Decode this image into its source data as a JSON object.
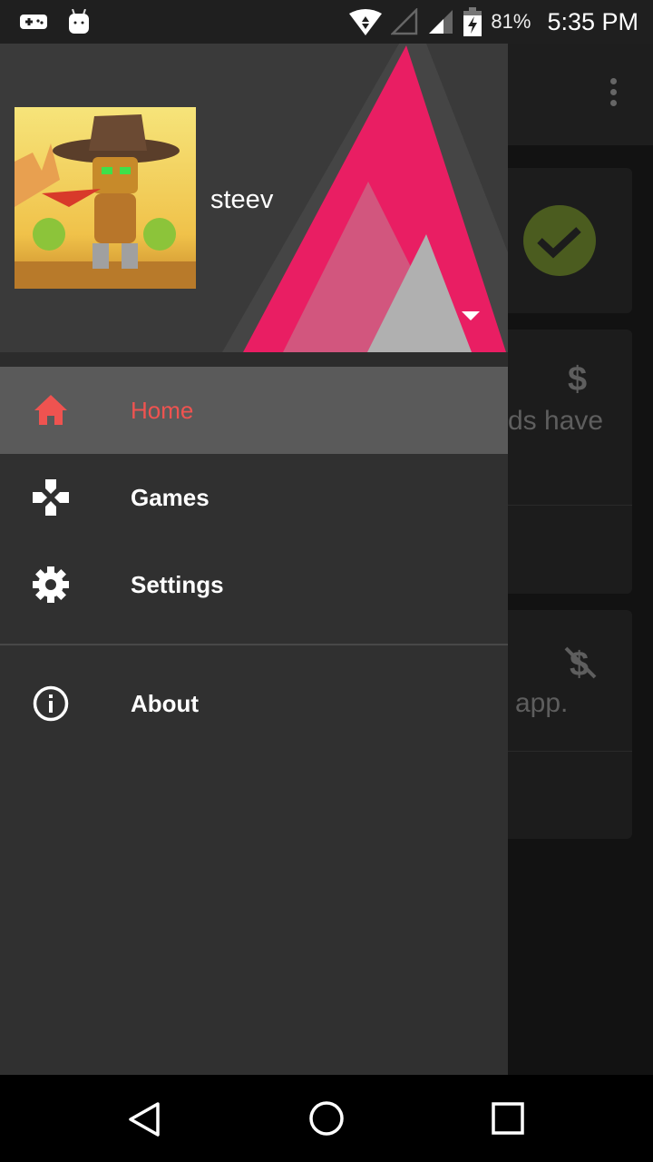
{
  "status_bar": {
    "battery": "81%",
    "time": "5:35 PM",
    "icons": [
      "gamepad-icon",
      "android-icon",
      "wifi-icon",
      "signal-empty-icon",
      "signal-icon",
      "battery-charging-icon"
    ]
  },
  "background": {
    "card2_text": "ds have",
    "card3_text": "app.",
    "icons": [
      "check-circle-icon",
      "dollar-icon",
      "no-dollar-icon",
      "more-vert-icon"
    ],
    "check_color": "#4b5c1f"
  },
  "drawer": {
    "username": "steev",
    "accent": "#e91e63",
    "items": [
      {
        "label": "Home",
        "icon": "home-icon",
        "selected": true,
        "color": "#ef5350"
      },
      {
        "label": "Games",
        "icon": "gamepad-icon"
      },
      {
        "label": "Settings",
        "icon": "gear-icon"
      },
      {
        "label": "About",
        "icon": "info-icon"
      }
    ]
  },
  "nav_bar": {
    "icons": [
      "back-icon",
      "home-circle-icon",
      "recents-icon"
    ]
  }
}
